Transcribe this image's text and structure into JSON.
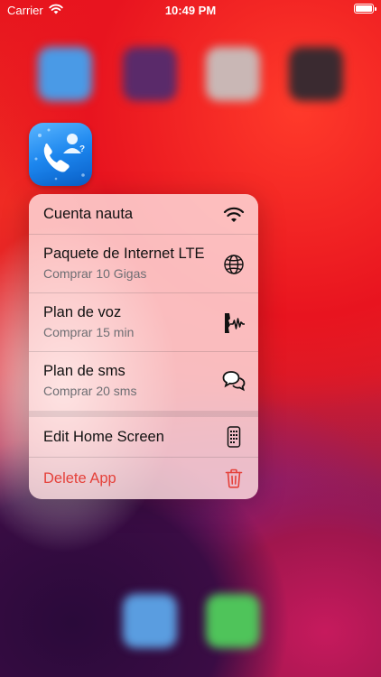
{
  "status_bar": {
    "carrier": "Carrier",
    "time": "10:49 PM"
  },
  "menu": {
    "items": [
      {
        "title": "Cuenta nauta",
        "icon": "wifi-icon"
      },
      {
        "title": "Paquete de Internet LTE",
        "subtitle": "Comprar 10 Gigas",
        "icon": "globe-icon"
      },
      {
        "title": "Plan de voz",
        "subtitle": "Comprar 15 min",
        "icon": "voice-wave-icon"
      },
      {
        "title": "Plan de sms",
        "subtitle": "Comprar 20 sms",
        "icon": "chat-bubbles-icon"
      }
    ],
    "system_items": [
      {
        "title": "Edit Home Screen",
        "icon": "phone-grid-icon"
      },
      {
        "title": "Delete App",
        "icon": "trash-icon",
        "color": "#e5413a"
      }
    ]
  },
  "colors": {
    "destructive": "#e5413a",
    "app_icon": "#1c86ee"
  }
}
